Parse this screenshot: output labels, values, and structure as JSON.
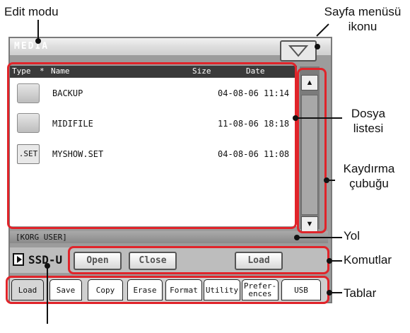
{
  "callouts": {
    "edit_mode": "Edit modu",
    "page_menu_icon": [
      "Sayfa menüsü",
      "ikonu"
    ],
    "file_list": [
      "Dosya",
      "listesi"
    ],
    "scrollbar": [
      "Kaydırma",
      "çubuğu"
    ],
    "path": "Yol",
    "commands": "Komutlar",
    "tabs": "Tablar"
  },
  "screen": {
    "title": "MEDIA",
    "columns": {
      "type": "Type",
      "sort_marker": "*",
      "name": "Name",
      "size": "Size",
      "date": "Date"
    },
    "files": [
      {
        "icon": "folder-icon",
        "type_label": "",
        "name": "BACKUP",
        "date": "04-08-06 11:14"
      },
      {
        "icon": "folder-icon",
        "type_label": "",
        "name": "MIDIFILE",
        "date": "11-08-06 18:18"
      },
      {
        "icon": "set-file-icon",
        "type_label": ".SET",
        "name": "MYSHOW.SET",
        "date": "04-08-06 11:08"
      }
    ],
    "path": "[KORG USER]",
    "drive": "SSD-U",
    "commands": {
      "open": "Open",
      "close": "Close",
      "load": "Load"
    },
    "tabs": [
      {
        "label": "Load",
        "active": true
      },
      {
        "label": "Save"
      },
      {
        "label": "Copy"
      },
      {
        "label": "Erase"
      },
      {
        "label": "Format"
      },
      {
        "label": "Utility"
      },
      {
        "label": "Prefer-\nences"
      },
      {
        "label": "USB"
      }
    ]
  },
  "colors": {
    "highlight": "#e0242a",
    "screen_bg": "#9c9c9c",
    "header_bg": "#3a3a3a"
  }
}
